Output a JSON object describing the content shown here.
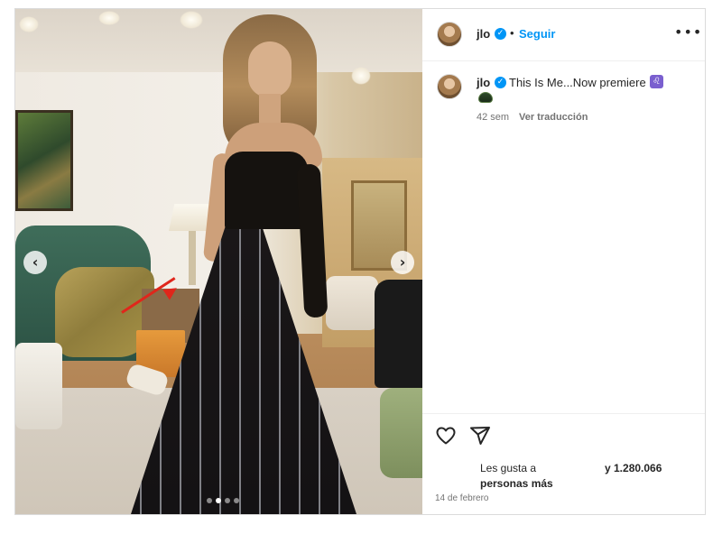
{
  "media": {
    "prev_icon": "chevron-left-icon",
    "next_icon": "chevron-right-icon",
    "prev_glyph": "‹",
    "next_glyph": "›",
    "carousel_count": 4,
    "carousel_active_index": 1
  },
  "header": {
    "username": "jlo",
    "verified_glyph": "✓",
    "separator": "•",
    "follow_label": "Seguir",
    "more_glyph": "•••"
  },
  "caption": {
    "username": "jlo",
    "verified_glyph": "✓",
    "text": "This Is Me...Now premiere",
    "emoji_glyph": "♌",
    "time": "42 sem",
    "translate_label": "Ver traducción"
  },
  "footer": {
    "likes_prefix": "Les gusta a",
    "likes_count": "y 1.280.066",
    "likes_suffix": "personas más",
    "date": "14 de febrero",
    "like_icon": "heart-icon",
    "share_icon": "send-icon"
  },
  "colors": {
    "accent": "#0095f6",
    "annotation_arrow": "#e0261b"
  }
}
